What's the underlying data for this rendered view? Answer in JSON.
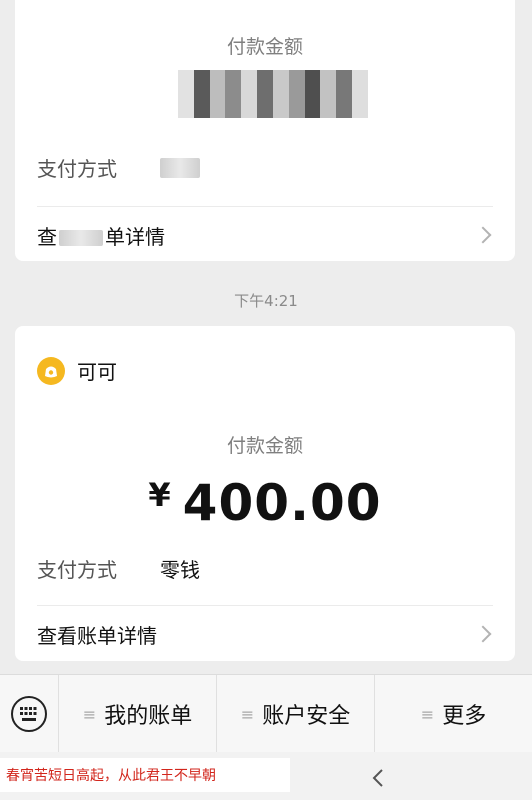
{
  "card1": {
    "amount_label": "付款金额",
    "payment_method_label": "支付方式",
    "detail_prefix": "查",
    "detail_suffix": "单详情"
  },
  "timestamp": "下午4:21",
  "card2": {
    "sender_name": "可可",
    "amount_label": "付款金额",
    "currency": "¥",
    "amount": "400.00",
    "payment_method_label": "支付方式",
    "payment_method_value": "零钱",
    "detail_label": "查看账单详情"
  },
  "menu": {
    "items": [
      {
        "label": "我的账单",
        "icon": "menu-lines-icon"
      },
      {
        "label": "账户安全",
        "icon": "menu-lines-icon"
      },
      {
        "label": "更多",
        "icon": "menu-lines-icon"
      }
    ]
  },
  "footer": {
    "poem": "春宵苦短日高起，从此君王不早朝"
  },
  "colors": {
    "background": "#ededed",
    "card": "#ffffff",
    "sender_icon": "#f5b820",
    "poem_text": "#d2261c"
  }
}
